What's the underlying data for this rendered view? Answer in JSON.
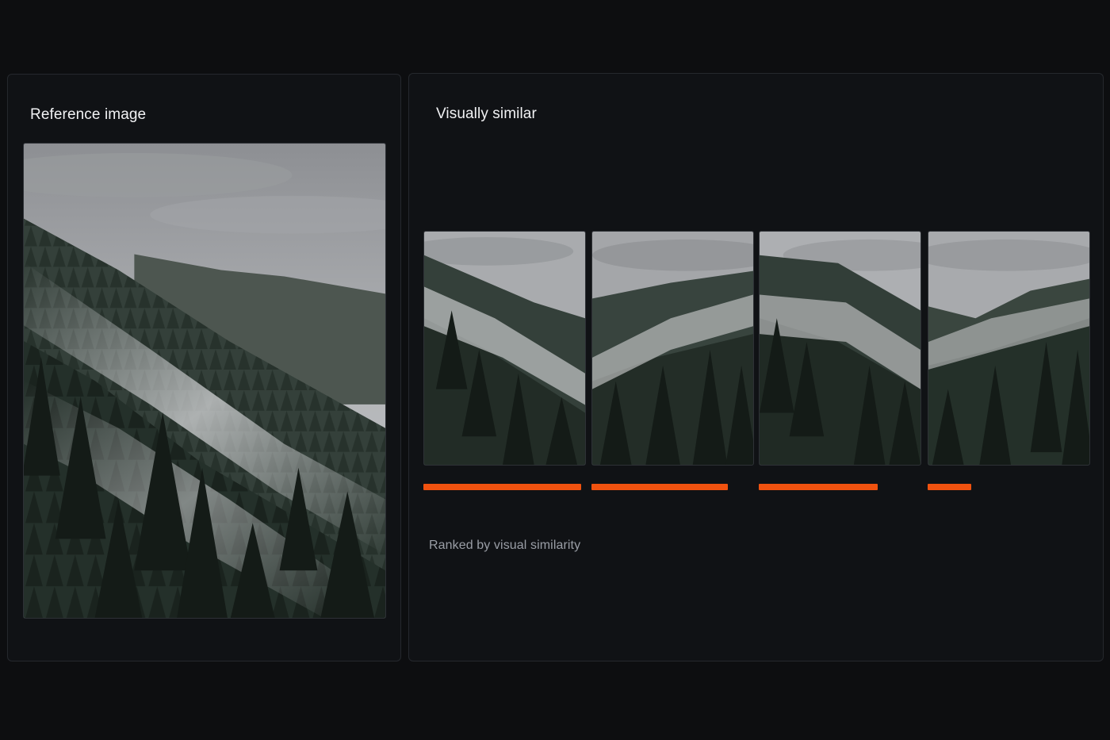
{
  "reference_panel": {
    "title": "Reference image"
  },
  "similar_panel": {
    "title": "Visually similar",
    "caption": "Ranked by visual similarity",
    "results": [
      {
        "rank": 1,
        "similarity": 0.97
      },
      {
        "rank": 2,
        "similarity": 0.84
      },
      {
        "rank": 3,
        "similarity": 0.73
      },
      {
        "rank": 4,
        "similarity": 0.27
      }
    ]
  },
  "colors": {
    "background": "#0d0e10",
    "panel": "#101215",
    "border": "#25282d",
    "accent": "#f0520f",
    "title_text": "#f1f2f4",
    "caption_text": "#9a9ea6"
  }
}
